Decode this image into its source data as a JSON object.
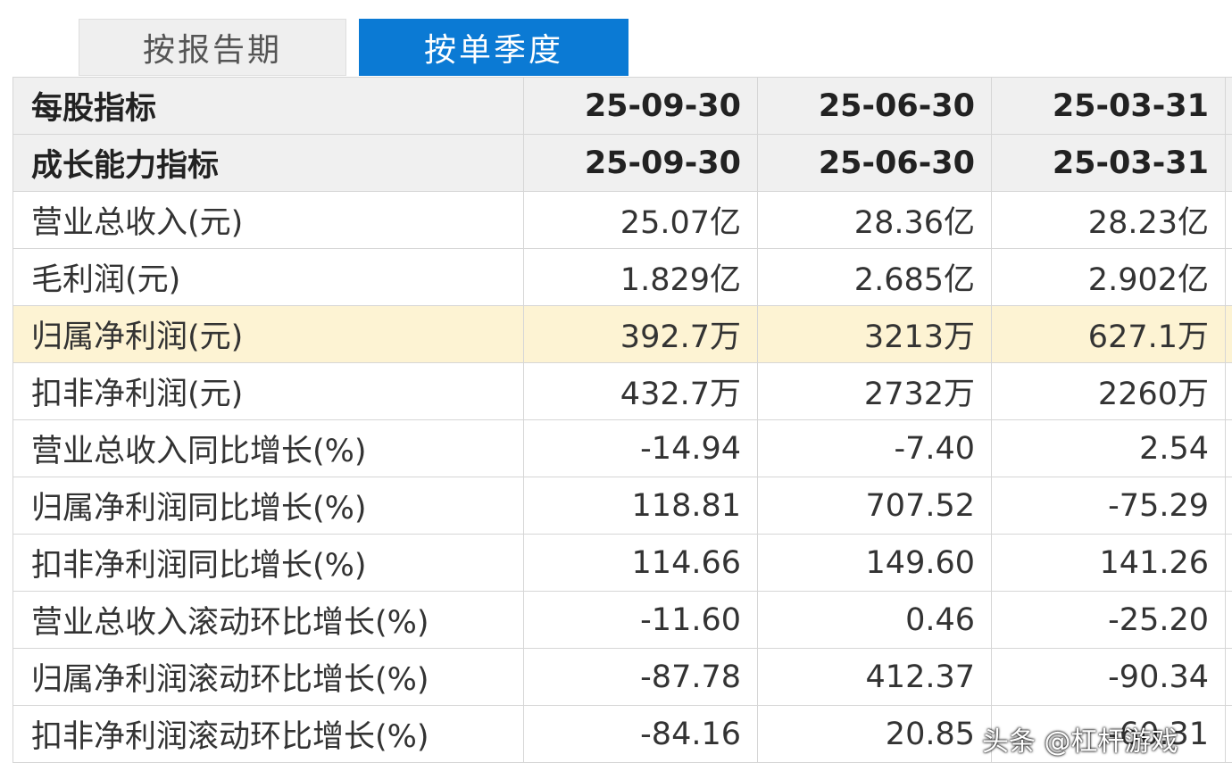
{
  "tabs": {
    "by_report_period": "按报告期",
    "by_quarter": "按单季度"
  },
  "table": {
    "header_rows": [
      {
        "label": "每股指标",
        "values": [
          "25-09-30",
          "25-06-30",
          "25-03-31"
        ]
      },
      {
        "label": "成长能力指标",
        "values": [
          "25-09-30",
          "25-06-30",
          "25-03-31"
        ]
      }
    ],
    "rows": [
      {
        "label": "营业总收入(元)",
        "values": [
          "25.07亿",
          "28.36亿",
          "28.23亿"
        ]
      },
      {
        "label": "毛利润(元)",
        "values": [
          "1.829亿",
          "2.685亿",
          "2.902亿"
        ]
      },
      {
        "label": "归属净利润(元)",
        "values": [
          "392.7万",
          "3213万",
          "627.1万"
        ],
        "highlighted": true
      },
      {
        "label": "扣非净利润(元)",
        "values": [
          "432.7万",
          "2732万",
          "2260万"
        ]
      },
      {
        "label": "营业总收入同比增长(%)",
        "values": [
          "-14.94",
          "-7.40",
          "2.54"
        ]
      },
      {
        "label": "归属净利润同比增长(%)",
        "values": [
          "118.81",
          "707.52",
          "-75.29"
        ]
      },
      {
        "label": "扣非净利润同比增长(%)",
        "values": [
          "114.66",
          "149.60",
          "141.26"
        ]
      },
      {
        "label": "营业总收入滚动环比增长(%)",
        "values": [
          "-11.60",
          "0.46",
          "-25.20"
        ]
      },
      {
        "label": "归属净利润滚动环比增长(%)",
        "values": [
          "-87.78",
          "412.37",
          "-90.34"
        ]
      },
      {
        "label": "扣非净利润滚动环比增长(%)",
        "values": [
          "-84.16",
          "20.85",
          "-60.31"
        ]
      }
    ]
  },
  "watermark": "头条 @杠杆游戏",
  "colors": {
    "active_tab": "#0b7ad4",
    "highlight_row": "#fdf3d3",
    "header_bg": "#f0f0f0"
  }
}
